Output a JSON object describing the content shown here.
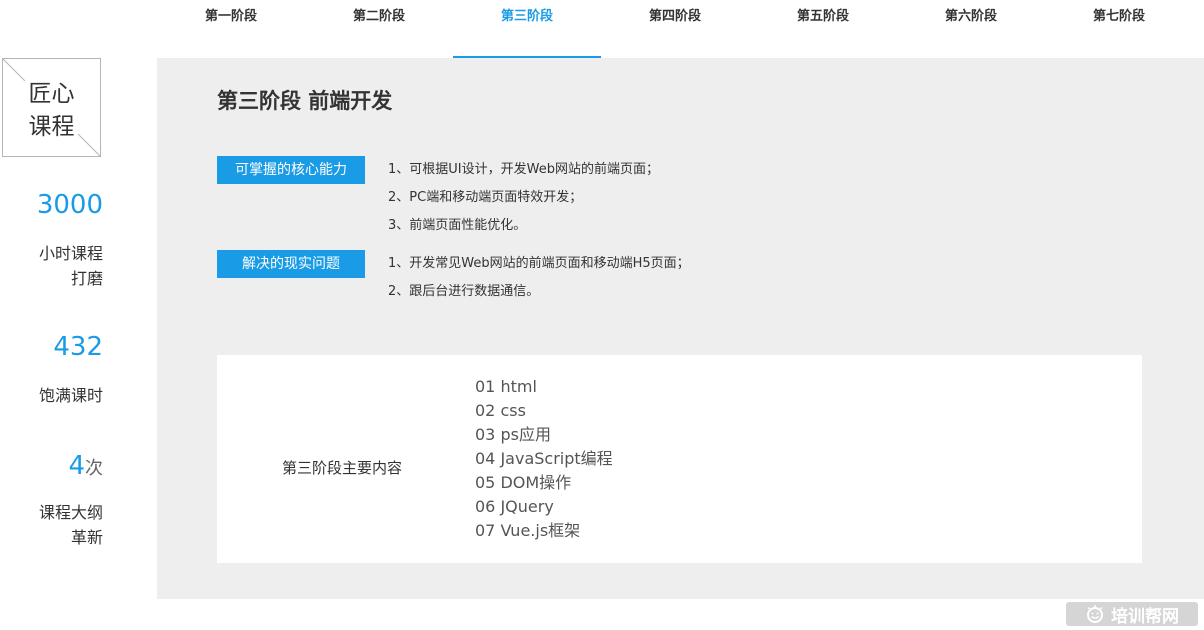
{
  "tabs": [
    {
      "label": "第一阶段",
      "active": false
    },
    {
      "label": "第二阶段",
      "active": false
    },
    {
      "label": "第三阶段",
      "active": true
    },
    {
      "label": "第四阶段",
      "active": false
    },
    {
      "label": "第五阶段",
      "active": false
    },
    {
      "label": "第六阶段",
      "active": false
    },
    {
      "label": "第七阶段",
      "active": false
    }
  ],
  "sidebar": {
    "badge": {
      "line1": "匠心",
      "line2": "课程"
    },
    "stats": [
      {
        "value": "3000",
        "unit": "",
        "label_line1": "小时课程",
        "label_line2": "打磨"
      },
      {
        "value": "432",
        "unit": "",
        "label_line1": "饱满课时",
        "label_line2": ""
      },
      {
        "value": "4",
        "unit": "次",
        "label_line1": "课程大纲",
        "label_line2": "革新"
      }
    ]
  },
  "stage": {
    "title": "第三阶段 前端开发",
    "core_ability": {
      "tag": "可掌握的核心能力",
      "items": [
        "1、可根据UI设计，开发Web网站的前端页面；",
        "2、PC端和移动端页面特效开发；",
        "3、前端页面性能优化。"
      ]
    },
    "problems": {
      "tag": "解决的现实问题",
      "items": [
        "1、开发常见Web网站的前端页面和移动端H5页面；",
        "2、跟后台进行数据通信。"
      ]
    },
    "content": {
      "label": "第三阶段主要内容",
      "modules": [
        "01 html",
        "02 css",
        "03 ps应用",
        "04 JavaScript编程",
        "05 DOM操作",
        "06 JQuery",
        "07 Vue.js框架"
      ]
    }
  },
  "watermark": {
    "text": "培训帮网",
    "icon": "smile-icon"
  },
  "colors": {
    "accent": "#1a9be6",
    "panel": "#eeeeee"
  }
}
